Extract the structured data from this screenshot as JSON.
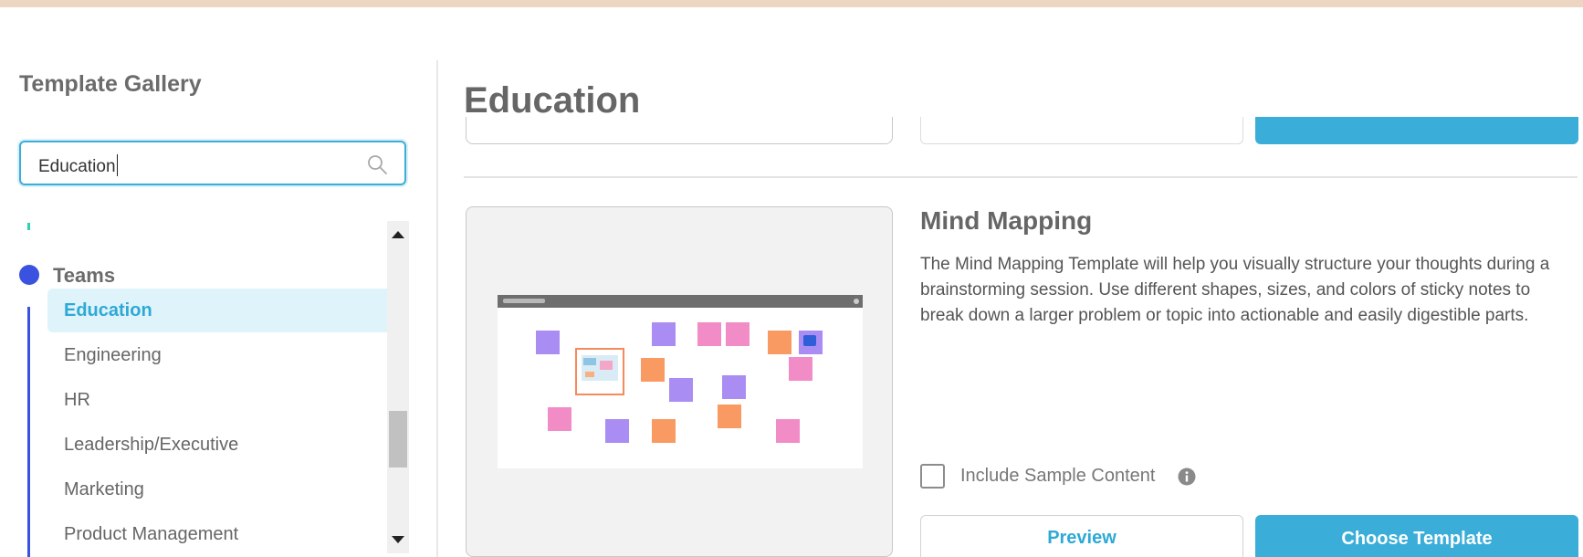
{
  "sidebar": {
    "title": "Template Gallery",
    "search": {
      "value": "Education",
      "icon": "search-icon"
    },
    "teams": {
      "label": "Teams",
      "dot_color": "#3b51e0",
      "items": [
        {
          "label": "Education",
          "selected": true
        },
        {
          "label": "Engineering"
        },
        {
          "label": "HR"
        },
        {
          "label": "Leadership/Executive"
        },
        {
          "label": "Marketing"
        },
        {
          "label": "Product Management"
        }
      ]
    }
  },
  "main": {
    "title": "Education",
    "template": {
      "title": "Mind Mapping",
      "description": "The Mind Mapping Template will help you visually structure your thoughts during a brainstorming session. Use different shapes, sizes, and colors of sticky notes to break down a larger problem or topic into actionable and easily digestible parts.",
      "include_sample_label": "Include Sample Content",
      "include_sample_checked": false,
      "preview_label": "Preview",
      "choose_label": "Choose Template"
    }
  },
  "colors": {
    "accent": "#3aaed8",
    "selected_bg": "#dff3fa",
    "sticky_purple": "#a98df2",
    "sticky_pink": "#f28cc6",
    "sticky_orange": "#f99a62"
  }
}
